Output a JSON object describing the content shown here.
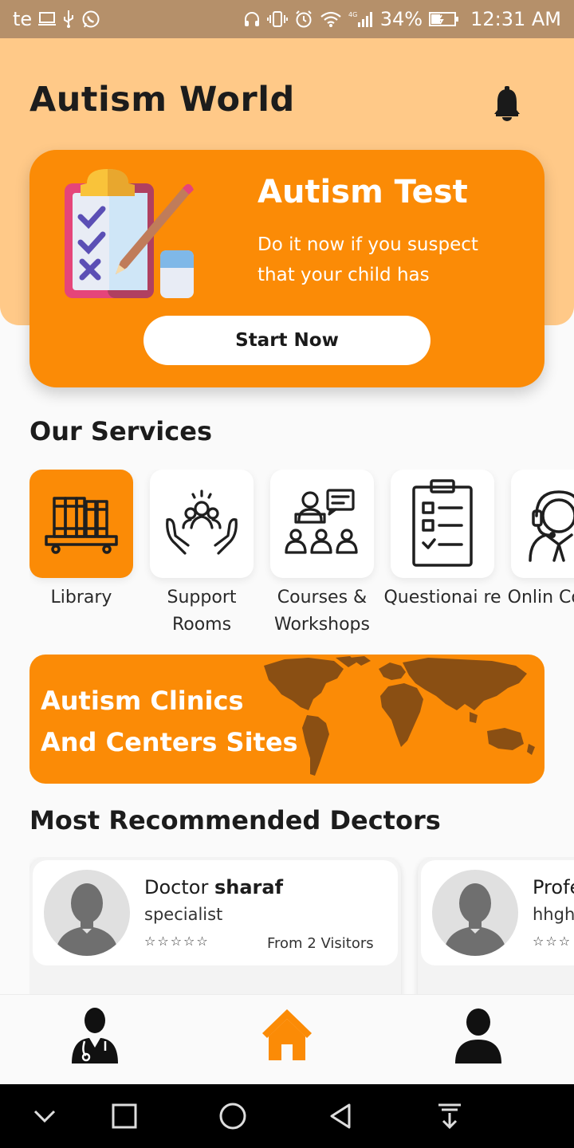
{
  "status_bar": {
    "carrier": "te",
    "battery": "34%",
    "time": "12:31 AM",
    "icons": [
      "screen-icon",
      "usb-icon",
      "whatsapp-icon",
      "headset-icon",
      "vibrate-icon",
      "alarm-icon",
      "wifi-icon",
      "signal-icon",
      "battery-icon"
    ]
  },
  "header": {
    "title": "Autism World",
    "bell_icon": "bell-icon"
  },
  "test_card": {
    "title": "Autism Test",
    "description": "Do it now if you suspect that your child has",
    "button_label": "Start Now"
  },
  "services": {
    "title": "Our Services",
    "items": [
      {
        "label": "Library",
        "icon": "bookshelf-icon",
        "active": true
      },
      {
        "label": "Support Rooms",
        "icon": "support-hands-icon",
        "active": false
      },
      {
        "label": "Courses & Workshops",
        "icon": "presentation-icon",
        "active": false
      },
      {
        "label": "Questionai re",
        "icon": "checklist-icon",
        "active": false
      },
      {
        "label": "Onlin Consul",
        "icon": "headset-agent-icon",
        "active": false
      }
    ]
  },
  "clinics_banner": {
    "line1": "Autism Clinics",
    "line2": "And Centers Sites"
  },
  "doctors": {
    "title": "Most Recommended Dectors",
    "items": [
      {
        "prefix": "Doctor",
        "name": "sharaf",
        "specialty": "specialist",
        "stars": "☆☆☆☆☆",
        "visitors": "From 2 Visitors"
      },
      {
        "prefix": "Profe",
        "name": "",
        "specialty": "hhghg",
        "stars": "☆☆☆",
        "visitors": ""
      }
    ]
  },
  "bottom_nav": {
    "items": [
      "doctor-icon",
      "home-icon",
      "profile-icon"
    ],
    "active": "home-icon"
  },
  "colors": {
    "accent": "#fb8b06",
    "header_bg": "#ffc988",
    "status_bar": "#b5906a"
  }
}
